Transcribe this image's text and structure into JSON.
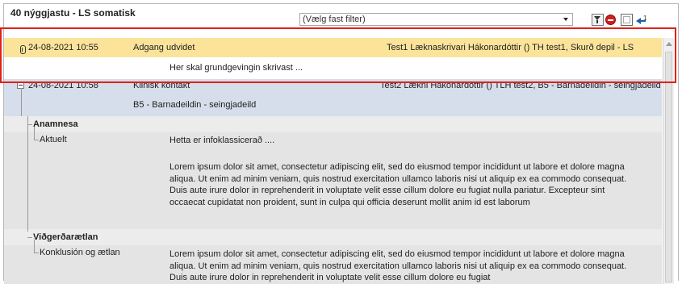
{
  "header": {
    "title": "40 nýggjastu - LS somatisk",
    "filter_value": "(Vælg fast filter)",
    "badge_number": "1"
  },
  "entry1": {
    "datetime": "24-08-2021  10:55",
    "type": "Adgang udvidet",
    "author": "Test1 Læknaskrivari Hákonardóttir () TH test1, Skurð depil - LS",
    "note": "Her skal grundgevingin skrivast ..."
  },
  "entry2": {
    "datetime": "24-08-2021  10:58",
    "type": "Klinisk kontakt",
    "author": "Test2 Lækni Hákonardóttir () TLH test2, B5 - Barnadeildin - seingjadeild",
    "department": "B5 - Barnadeildin - seingjadeild",
    "section1": {
      "heading": "Anamnesa",
      "subheading": "Aktuelt",
      "text_short": "Hetta er infoklassicerað ....",
      "text_long": "Lorem ipsum dolor sit amet, consectetur adipiscing elit, sed do eiusmod tempor incididunt ut labore et dolore magna aliqua. Ut enim ad minim veniam, quis nostrud exercitation ullamco laboris nisi ut aliquip ex ea commodo consequat. Duis aute irure dolor in reprehenderit in voluptate velit esse cillum dolore eu fugiat nulla pariatur. Excepteur sint occaecat cupidatat non proident, sunt in culpa qui officia deserunt mollit anim id est laborum"
    },
    "section2": {
      "heading": "Viðgerðarætlan",
      "subheading": "Konklusión og ætlan",
      "text_long": "Lorem ipsum dolor sit amet, consectetur adipiscing elit, sed do eiusmod tempor incididunt ut labore et dolore magna aliqua. Ut enim ad minim veniam, quis nostrud exercitation ullamco laboris nisi ut aliquip ex ea commodo consequat. Duis aute irure dolor in reprehenderit in voluptate velit esse cillum dolore eu fugiat"
    }
  },
  "icons": {
    "filter": "funnel-icon",
    "stop": "stop-icon",
    "box": "checkbox-icon",
    "back": "arrow-left-icon",
    "attachment": "paperclip-icon",
    "collapse": "minus-box-icon"
  },
  "colors": {
    "highlight_row": "#fbe49a",
    "entry_row": "#d5deea",
    "annotation_box": "#e0201b"
  }
}
